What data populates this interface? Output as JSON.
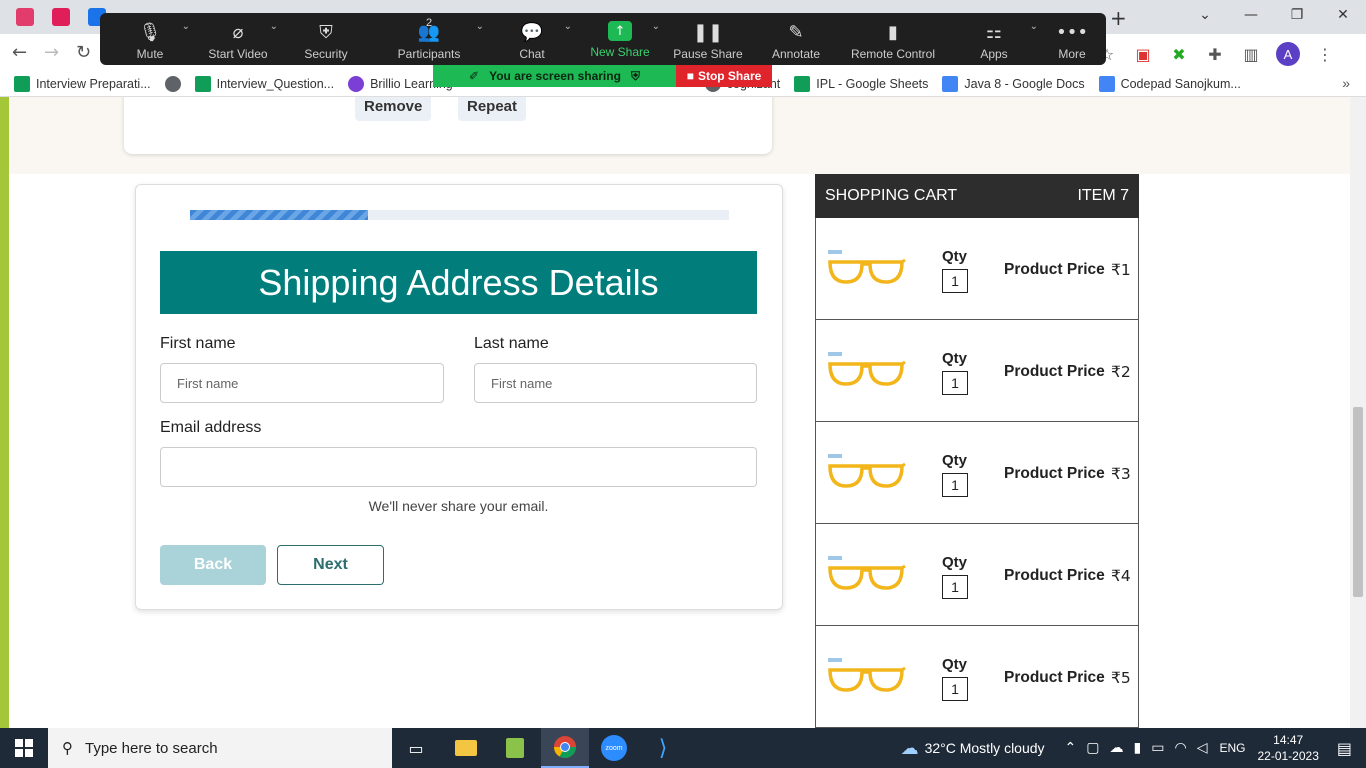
{
  "browser": {
    "bookmarks": [
      {
        "label": "Interview Preparati...",
        "icon": "sheets-icon"
      },
      {
        "label": "",
        "icon": "globe-icon"
      },
      {
        "label": "Interview_Question...",
        "icon": "sheets-icon"
      },
      {
        "label": "Brillio Learning",
        "icon": "brillio-icon"
      },
      {
        "label": "cognizant",
        "icon": "globe-icon"
      },
      {
        "label": "IPL - Google Sheets",
        "icon": "sheets-icon"
      },
      {
        "label": "Java 8 - Google Docs",
        "icon": "docs-icon"
      },
      {
        "label": "Codepad Sanojkum...",
        "icon": "docs-icon"
      }
    ],
    "avatar_letter": "A"
  },
  "zoom": {
    "buttons": [
      {
        "label": "Mute",
        "icon": "microphone-icon"
      },
      {
        "label": "Start Video",
        "icon": "video-off-icon"
      },
      {
        "label": "Security",
        "icon": "shield-icon"
      },
      {
        "label": "Participants",
        "icon": "participants-icon",
        "count": "2"
      },
      {
        "label": "Chat",
        "icon": "chat-icon"
      },
      {
        "label": "New Share",
        "icon": "share-up-icon"
      },
      {
        "label": "Pause Share",
        "icon": "pause-icon"
      },
      {
        "label": "Annotate",
        "icon": "pencil-icon"
      },
      {
        "label": "Remote Control",
        "icon": "mouse-icon"
      },
      {
        "label": "Apps",
        "icon": "apps-icon"
      },
      {
        "label": "More",
        "icon": "more-icon"
      }
    ],
    "sharing_text": "You are screen sharing",
    "stop_share": "Stop Share"
  },
  "previous_card": {
    "remove_label": "Remove",
    "repeat_label": "Repeat"
  },
  "form": {
    "progress_fraction": 0.33,
    "title": "Shipping Address Details",
    "first_name_label": "First name",
    "first_name_placeholder": "First name",
    "last_name_label": "Last name",
    "last_name_placeholder": "First name",
    "email_label": "Email address",
    "email_placeholder": "",
    "email_help": "We'll never share your email.",
    "back_label": "Back",
    "next_label": "Next"
  },
  "cart": {
    "title": "SHOPPING CART",
    "item_count": "ITEM 7",
    "qty_label": "Qty",
    "price_label": "Product Price",
    "items": [
      {
        "qty": "1",
        "price": "₹1"
      },
      {
        "qty": "1",
        "price": "₹2"
      },
      {
        "qty": "1",
        "price": "₹3"
      },
      {
        "qty": "1",
        "price": "₹4"
      },
      {
        "qty": "1",
        "price": "₹5"
      }
    ]
  },
  "taskbar": {
    "search_placeholder": "Type here to search",
    "weather": "32°C  Mostly cloudy",
    "language": "ENG",
    "time": "14:47",
    "date": "22-01-2023"
  }
}
